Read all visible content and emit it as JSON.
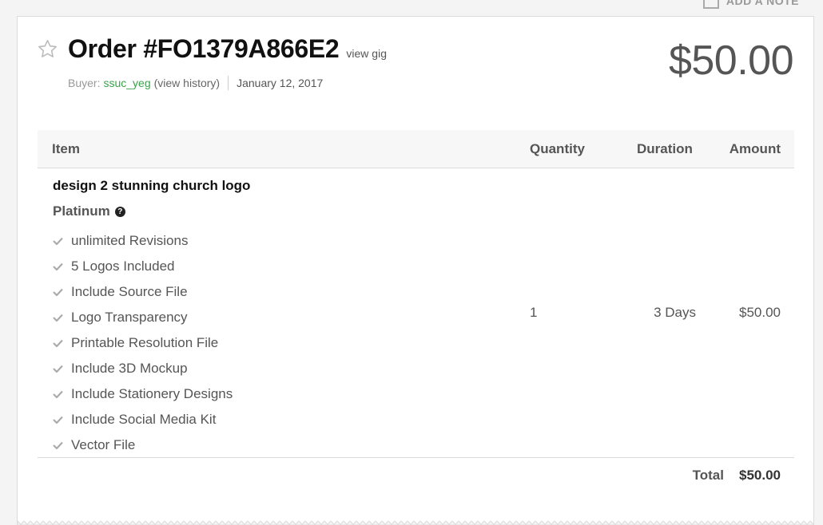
{
  "add_note": {
    "label": "ADD A NOTE",
    "icon": "note-icon"
  },
  "order": {
    "title": "Order #FO1379A866E2",
    "view_gig": "view gig",
    "buyer_label": "Buyer:",
    "buyer_name": "ssuc_yeg",
    "view_history": "(view history)",
    "date": "January 12, 2017",
    "price": "$50.00",
    "star_icon": "star-outline-icon"
  },
  "table": {
    "headers": {
      "item": "Item",
      "quantity": "Quantity",
      "duration": "Duration",
      "amount": "Amount"
    },
    "row": {
      "gig_title": "design 2 stunning church logo",
      "package": "Platinum",
      "help_icon": "question-circle-icon",
      "features": [
        "unlimited Revisions",
        "5 Logos Included",
        "Include Source File",
        "Logo Transparency",
        "Printable Resolution File",
        "Include 3D Mockup",
        "Include Stationery Designs",
        "Include Social Media Kit",
        "Vector File"
      ],
      "quantity": "1",
      "duration": "3 Days",
      "amount": "$50.00"
    },
    "total_label": "Total",
    "total_value": "$50.00"
  },
  "colors": {
    "buyer_link": "#3aa24a",
    "check": "#aaaaaa",
    "header_bg": "#f7f7f7"
  }
}
